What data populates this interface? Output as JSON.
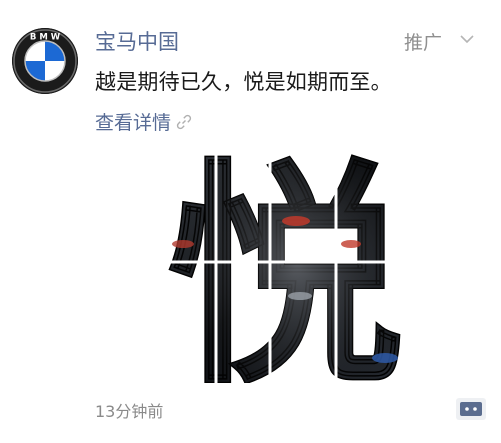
{
  "post": {
    "account_name": "宝马中国",
    "ad_label": "推广",
    "message": "越是期待已久，悦是如期而至。",
    "detail_link": "查看详情",
    "timestamp": "13分钟前",
    "hero_glyph": "悦",
    "avatar_icon": "bmw-logo-icon",
    "link_icon": "link-icon",
    "more_icon": "chevron-down-icon",
    "comment_icon": "comment-icon"
  },
  "colors": {
    "name": "#576b95",
    "text": "#1a1a1a",
    "muted": "#8a8a8a",
    "logo_blue": "#1c69d4"
  }
}
